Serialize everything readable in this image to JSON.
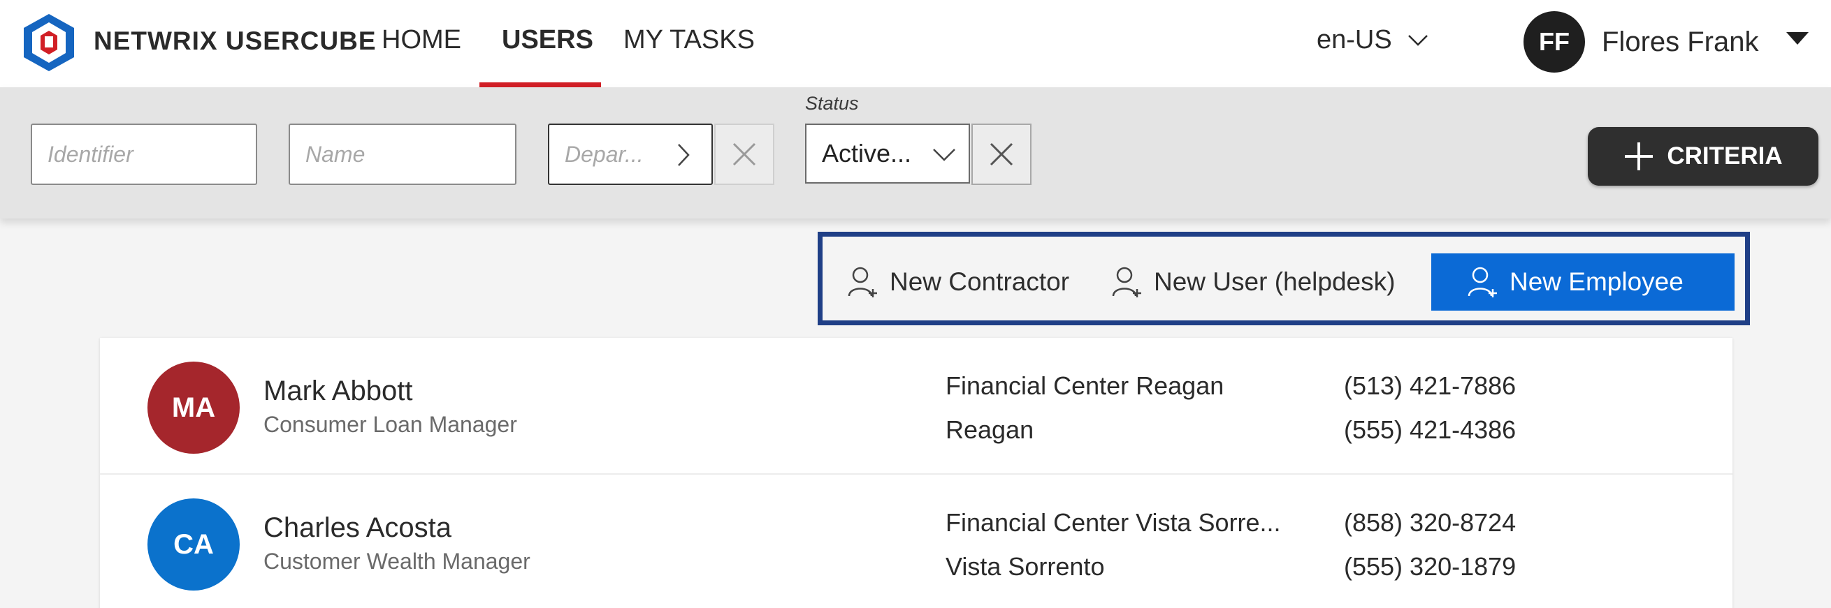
{
  "app": {
    "brand": "NETWRIX USERCUBE",
    "nav": [
      {
        "label": "HOME",
        "active": false
      },
      {
        "label": "USERS",
        "active": true
      },
      {
        "label": "MY TASKS",
        "active": false
      }
    ],
    "language": "en-US",
    "user": {
      "initials": "FF",
      "name": "Flores Frank"
    },
    "accent_color": "#d11f26"
  },
  "filters": {
    "identifier_placeholder": "Identifier",
    "name_placeholder": "Name",
    "department_placeholder": "Depar...",
    "status_label": "Status",
    "status_value": "Active...",
    "criteria_label": "CRITERIA"
  },
  "actions": {
    "new_contractor": "New Contractor",
    "new_user_helpdesk": "New User (helpdesk)",
    "new_employee": "New Employee"
  },
  "users": [
    {
      "initials": "MA",
      "avatar_color": "#a5262c",
      "name": "Mark Abbott",
      "title": "Consumer Loan Manager",
      "location": "Financial Center Reagan",
      "site": "Reagan",
      "phone1": "(513) 421-7886",
      "phone2": "(555) 421-4386"
    },
    {
      "initials": "CA",
      "avatar_color": "#0b72cc",
      "name": "Charles Acosta",
      "title": "Customer Wealth Manager",
      "location": "Financial Center Vista Sorre...",
      "site": "Vista Sorrento",
      "phone1": "(858) 320-8724",
      "phone2": "(555) 320-1879"
    }
  ]
}
